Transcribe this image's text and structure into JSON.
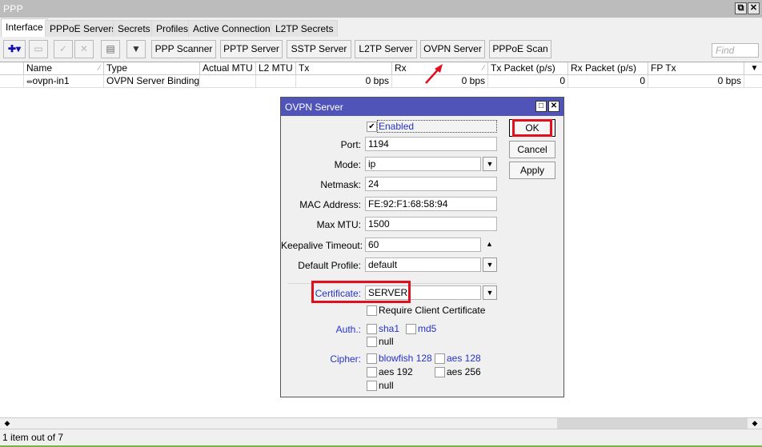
{
  "window": {
    "title": "PPP",
    "restore_label": "⧉",
    "close_label": "✕"
  },
  "tabs": [
    {
      "label": "Interface",
      "active": true
    },
    {
      "label": "PPPoE Servers",
      "active": false
    },
    {
      "label": "Secrets",
      "active": false
    },
    {
      "label": "Profiles",
      "active": false
    },
    {
      "label": "Active Connections",
      "active": false
    },
    {
      "label": "L2TP Secrets",
      "active": false
    }
  ],
  "toolbar": {
    "add_icon": "✚▾",
    "remove_icon": "▭",
    "enable_icon": "✓",
    "disable_icon": "✕",
    "comment_icon": "▤",
    "filter_icon": "▼",
    "buttons": [
      "PPP Scanner",
      "PPTP Server",
      "SSTP Server",
      "L2TP Server",
      "OVPN Server",
      "PPPoE Scan"
    ],
    "find_placeholder": "Find"
  },
  "table": {
    "columns": [
      "Name",
      "Type",
      "Actual MTU",
      "L2 MTU",
      "Tx",
      "Rx",
      "Tx Packet (p/s)",
      "Rx Packet (p/s)",
      "FP Tx"
    ],
    "sort_indicator": "∕",
    "menu_icon": "▼",
    "rows": [
      {
        "icon": "⇹",
        "name": "ovpn-in1",
        "type": "OVPN Server Binding",
        "actual_mtu": "",
        "l2_mtu": "",
        "tx": "0 bps",
        "rx": "0 bps",
        "tx_packet": "0",
        "rx_packet": "0",
        "fp_tx": "0 bps"
      }
    ]
  },
  "status": {
    "text": "1 item out of 7"
  },
  "scrollbar": {
    "left_arrow": "◆",
    "right_arrow": "◆"
  },
  "dialog": {
    "title": "OVPN Server",
    "restore_label": "□",
    "close_label": "✕",
    "enabled": {
      "label": "Enabled",
      "checked": true
    },
    "fields": {
      "port": {
        "label": "Port:",
        "value": "1194"
      },
      "mode": {
        "label": "Mode:",
        "value": "ip"
      },
      "netmask": {
        "label": "Netmask:",
        "value": "24"
      },
      "mac_address": {
        "label": "MAC Address:",
        "value": "FE:92:F1:68:58:94"
      },
      "max_mtu": {
        "label": "Max MTU:",
        "value": "1500"
      },
      "keepalive_timeout": {
        "label": "Keepalive Timeout:",
        "value": "60"
      },
      "default_profile": {
        "label": "Default Profile:",
        "value": "default"
      },
      "certificate": {
        "label": "Certificate:",
        "value": "SERVER"
      }
    },
    "require_client_certificate": {
      "label": "Require Client Certificate",
      "checked": false
    },
    "auth": {
      "label": "Auth.:",
      "options": [
        {
          "label": "sha1",
          "checked": false
        },
        {
          "label": "md5",
          "checked": false
        },
        {
          "label": "null",
          "checked": false
        }
      ]
    },
    "cipher": {
      "label": "Cipher:",
      "options": [
        {
          "label": "blowfish 128",
          "checked": false
        },
        {
          "label": "aes 128",
          "checked": false
        },
        {
          "label": "aes 192",
          "checked": false
        },
        {
          "label": "aes 256",
          "checked": false
        },
        {
          "label": "null",
          "checked": false
        }
      ]
    },
    "buttons": {
      "ok": "OK",
      "cancel": "Cancel",
      "apply": "Apply"
    },
    "dropdown_icon": "▼",
    "spin_up_icon": "▲",
    "check_mark": "✔"
  },
  "annotation": {
    "highlight_color": "#e0101e",
    "arrow_color": "#e0101e"
  }
}
